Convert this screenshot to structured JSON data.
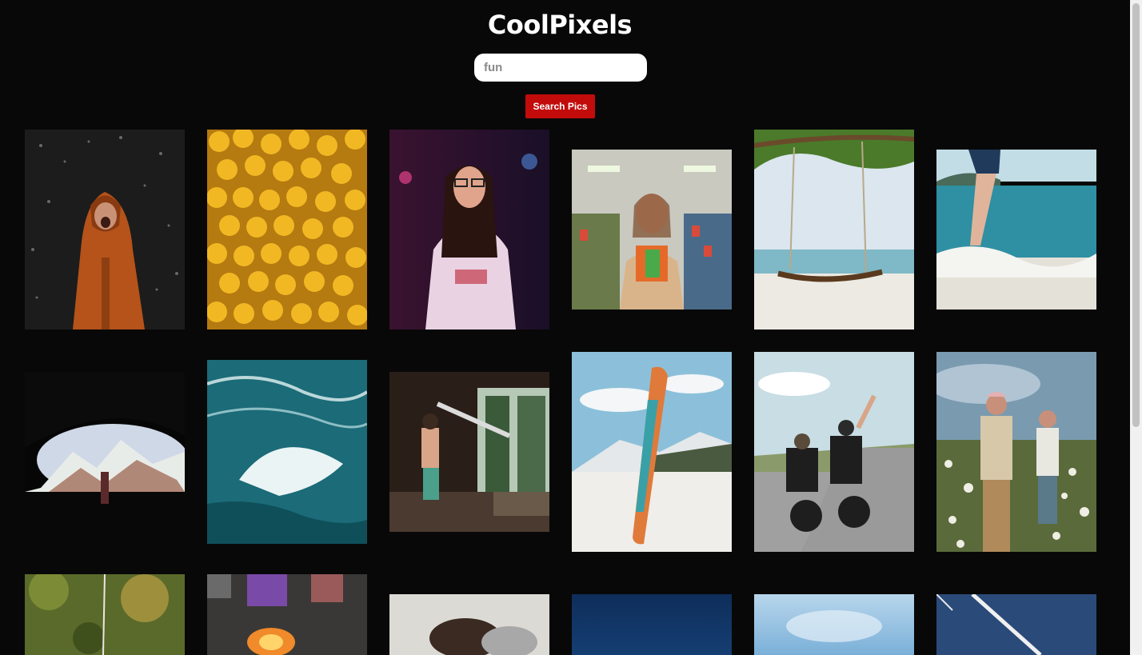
{
  "app": {
    "title": "CoolPixels"
  },
  "search": {
    "value": "fun",
    "button_label": "Search Pics"
  },
  "gallery": {
    "photos": [
      {
        "name": "photo-girl-in-rain",
        "subject": "girl in orange raincoat laughing in the rain"
      },
      {
        "name": "photo-yellow-beads",
        "subject": "pile of yellow face beads"
      },
      {
        "name": "photo-woman-glasses-neon",
        "subject": "woman with glasses on neon street"
      },
      {
        "name": "photo-girl-candy-store",
        "subject": "girl holding candy in store aisle"
      },
      {
        "name": "photo-beach-swing",
        "subject": "rope swing on a beach"
      },
      {
        "name": "photo-foot-splash",
        "subject": "foot splashing in sea water"
      },
      {
        "name": "photo-cave-mountains",
        "subject": "view of mountains from a cave"
      },
      {
        "name": "photo-ocean-wave",
        "subject": "ocean wave from above"
      },
      {
        "name": "photo-kid-telescope",
        "subject": "child looking through telescope at window"
      },
      {
        "name": "photo-snowboard",
        "subject": "snowboard standing in snow"
      },
      {
        "name": "photo-motorcyclists",
        "subject": "motorcyclists on a road"
      },
      {
        "name": "photo-couple-flowers",
        "subject": "couple in field of flowers"
      },
      {
        "name": "photo-trees-bokeh",
        "subject": "trees with bokeh"
      },
      {
        "name": "photo-campfire",
        "subject": "people around a campfire"
      },
      {
        "name": "photo-person-lying",
        "subject": "person lying down"
      },
      {
        "name": "photo-dark-blue",
        "subject": "dark blue sky"
      },
      {
        "name": "photo-light-sky",
        "subject": "light blue sky"
      },
      {
        "name": "photo-blue-line",
        "subject": "blue surface with white line"
      }
    ]
  },
  "colors": {
    "background": "#080808",
    "button": "#c20b0b",
    "title": "#ffffff"
  }
}
